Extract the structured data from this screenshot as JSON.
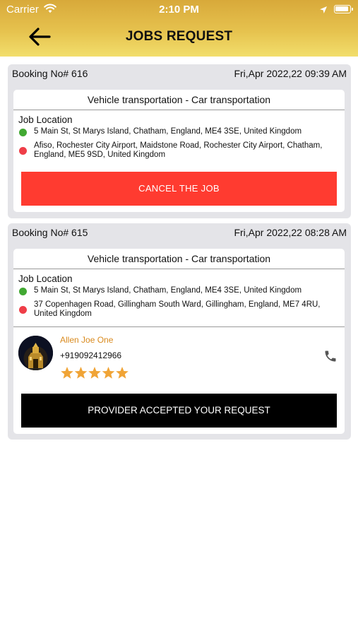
{
  "status_bar": {
    "carrier": "Carrier",
    "time": "2:10 PM"
  },
  "header": {
    "title": "JOBS REQUEST"
  },
  "bookings": [
    {
      "booking_no": "Booking No# 616",
      "date": "Fri,Apr 2022,22 09:39 AM",
      "service": "Vehicle transportation - Car transportation",
      "job_location_label": "Job Location",
      "pickup": "5 Main St, St Marys Island, Chatham, England, ME4 3SE, United Kingdom",
      "dropoff": "Afiso, Rochester City Airport, Maidstone Road, Rochester City Airport, Chatham, England, ME5 9SD, United Kingdom",
      "action_label": "CANCEL THE JOB"
    },
    {
      "booking_no": "Booking No# 615",
      "date": "Fri,Apr 2022,22 08:28 AM",
      "service": "Vehicle transportation - Car transportation",
      "job_location_label": "Job Location",
      "pickup": "5 Main St, St Marys Island, Chatham, England, ME4 3SE, United Kingdom",
      "dropoff": "37 Copenhagen Road, Gillingham South Ward, Gillingham, England, ME7 4RU, United Kingdom",
      "provider": {
        "name": "Allen Joe One",
        "phone": "+919092412966",
        "rating": 5
      },
      "action_label": "PROVIDER ACCEPTED YOUR REQUEST"
    }
  ],
  "colors": {
    "header_top": "#d8a93a",
    "header_bottom": "#f2de6c",
    "cancel": "#ff3b30",
    "accepted": "#000000",
    "star": "#f0a436",
    "pickup_dot": "#41a832",
    "dropoff_dot": "#ef3e48",
    "provider_name": "#d98a1e"
  },
  "icons": {
    "back": "back-arrow-icon",
    "phone": "phone-icon",
    "wifi": "wifi-icon",
    "location": "location-arrow-icon",
    "battery": "battery-icon",
    "star": "star-icon"
  }
}
